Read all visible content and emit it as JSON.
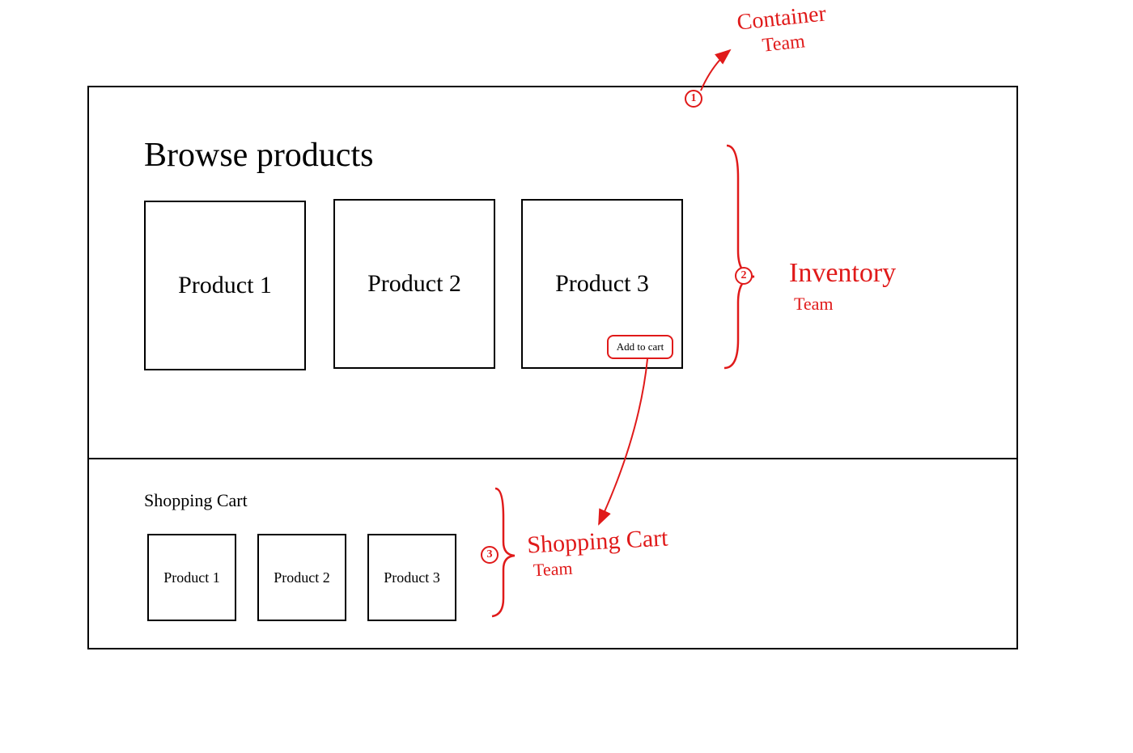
{
  "diagram": {
    "title_browse": "Browse products",
    "title_cart": "Shopping Cart",
    "products": [
      "Product 1",
      "Product 2",
      "Product 3"
    ],
    "cart_items": [
      "Product 1",
      "Product 2",
      "Product 3"
    ],
    "add_to_cart_label": "Add to cart"
  },
  "annotations": {
    "container": {
      "number": "1",
      "line1": "Container",
      "line2": "Team"
    },
    "inventory": {
      "number": "2",
      "line1": "Inventory",
      "line2": "Team"
    },
    "shopping_cart": {
      "number": "3",
      "line1": "Shopping Cart",
      "line2": "Team"
    }
  },
  "colors": {
    "annotation": "#e01a1a",
    "box": "#000000"
  }
}
